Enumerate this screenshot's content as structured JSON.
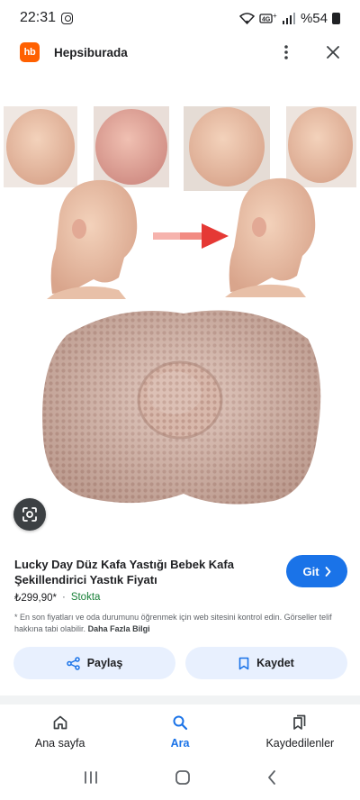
{
  "status_bar": {
    "time": "22:31",
    "signal_text": "⁺",
    "battery": "%54"
  },
  "header": {
    "logo_text": "hb",
    "site_name": "Hepsiburada"
  },
  "product": {
    "title": "Lucky Day Düz Kafa Yastığı Bebek Kafa Şekillendirici Yastık Fiyatı",
    "go_label": "Git",
    "price": "₺299,90*",
    "separator": "·",
    "stock": "Stokta",
    "disclaimer": "* En son fiyatları ve oda durumunu öğrenmek için web sitesini kontrol edin. Görseller telif hakkına tabi olabilir.",
    "more_info": "Daha Fazla Bilgi"
  },
  "actions": {
    "share_label": "Paylaş",
    "save_label": "Kaydet"
  },
  "bottom_nav": {
    "items": [
      {
        "label": "Ana sayfa",
        "icon": "home-icon"
      },
      {
        "label": "Ara",
        "icon": "search-icon"
      },
      {
        "label": "Kaydedilenler",
        "icon": "bookmarks-icon"
      }
    ]
  },
  "colors": {
    "accent": "#1a73e8",
    "brand": "#ff6000",
    "stock": "#188038"
  }
}
